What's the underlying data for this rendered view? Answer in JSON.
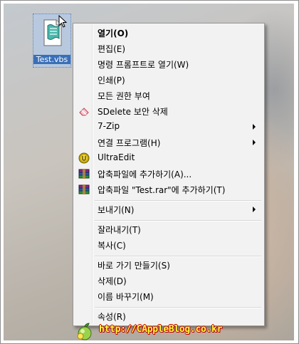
{
  "desktop": {
    "file_icon": {
      "label": "Test.vbs",
      "icon": "vbs-script-icon"
    }
  },
  "context_menu": {
    "items": [
      {
        "label": "열기(O)",
        "bold": true
      },
      {
        "label": "편집(E)"
      },
      {
        "label": "명령 프롬프트로 열기(W)"
      },
      {
        "label": "인쇄(P)"
      },
      {
        "label": "모든 권한 부여"
      },
      {
        "label": "SDelete 보안 삭제",
        "icon": "eraser-icon"
      },
      {
        "label": "7-Zip",
        "submenu": true
      },
      {
        "label": "연결 프로그램(H)",
        "submenu": true
      },
      {
        "label": "UltraEdit",
        "icon": "ultraedit-icon"
      },
      {
        "label": "압축파일에 추가하기(A)...",
        "icon": "winrar-books-icon"
      },
      {
        "label": "압축파일 \"Test.rar\"에 추가하기(T)",
        "icon": "winrar-books-icon"
      },
      {
        "label": "보내기(N)",
        "submenu": true
      },
      {
        "label": "잘라내기(T)"
      },
      {
        "label": "복사(C)"
      },
      {
        "label": "바로 가기 만들기(S)"
      },
      {
        "label": "삭제(D)"
      },
      {
        "label": "이름 바꾸기(M)"
      },
      {
        "label": "속성(R)"
      }
    ]
  },
  "watermark": {
    "text": "http://CAppleBlog.co.kr",
    "icon": "apple-logo-icon"
  }
}
